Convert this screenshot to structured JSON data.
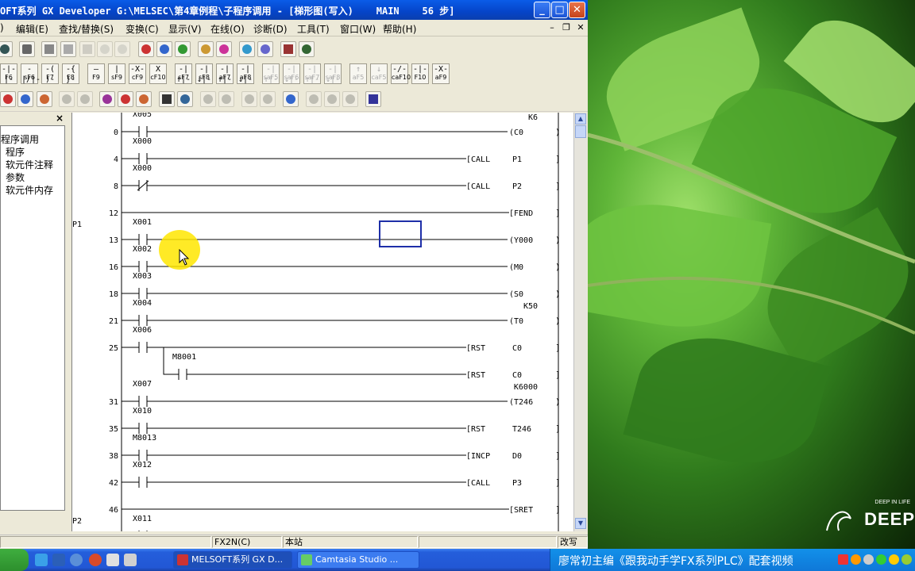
{
  "window": {
    "title": "OFT系列 GX Developer G:\\MELSEC\\第4章例程\\子程序调用 - [梯形图(写入)    MAIN    56 步]"
  },
  "menu": [
    "编辑(E)",
    "查找/替换(S)",
    "变换(C)",
    "显示(V)",
    "在线(O)",
    "诊断(D)",
    "工具(T)",
    "窗口(W)",
    "帮助(H)"
  ],
  "fkeys": [
    {
      "sym": "-|-|-",
      "label": "F6",
      "enabled": true
    },
    {
      "sym": "-|/|-",
      "label": "sF6",
      "enabled": true
    },
    {
      "sym": "-( )-",
      "label": "F7",
      "enabled": true
    },
    {
      "sym": "-{ }-",
      "label": "F8",
      "enabled": true
    },
    {
      "sym": "—",
      "label": "F9",
      "enabled": true
    },
    {
      "sym": "|",
      "label": "sF9",
      "enabled": true
    },
    {
      "sym": "-X-",
      "label": "cF9",
      "enabled": true
    },
    {
      "sym": "X",
      "label": "cF10",
      "enabled": true
    },
    {
      "sym": "-|↑|-",
      "label": "sF7",
      "enabled": true
    },
    {
      "sym": "-|↓|-",
      "label": "sF8",
      "enabled": true
    },
    {
      "sym": "-|↑|-",
      "label": "aF7",
      "enabled": true
    },
    {
      "sym": "-|↓|-",
      "label": "aF8",
      "enabled": true
    },
    {
      "sym": "-|↑|-",
      "label": "saF5",
      "enabled": false
    },
    {
      "sym": "-|↓|-",
      "label": "saF6",
      "enabled": false
    },
    {
      "sym": "-|↑|-",
      "label": "saF7",
      "enabled": false
    },
    {
      "sym": "-|↓|-",
      "label": "saF8",
      "enabled": false
    },
    {
      "sym": "↑",
      "label": "aF5",
      "enabled": false
    },
    {
      "sym": "↓",
      "label": "caF5",
      "enabled": false
    },
    {
      "sym": "-/-",
      "label": "caF10",
      "enabled": true
    },
    {
      "sym": "-|-",
      "label": "F10",
      "enabled": true
    },
    {
      "sym": "-X-",
      "label": "aF9",
      "enabled": true
    }
  ],
  "tree": {
    "items": [
      "程序调用",
      "程序",
      "软元件注释",
      "参数",
      "软元件内存"
    ],
    "close": "×"
  },
  "ladder": {
    "rungs": [
      {
        "step": "0",
        "contacts": [
          {
            "dev": "X005",
            "type": "no"
          }
        ],
        "coil": "(C0",
        "coil_type": "out",
        "k": "K6"
      },
      {
        "step": "4",
        "contacts": [
          {
            "dev": "X000",
            "type": "no"
          }
        ],
        "coil": "[CALL",
        "arg": "P1",
        "coil_type": "inst"
      },
      {
        "step": "8",
        "contacts": [
          {
            "dev": "X000",
            "type": "nc"
          }
        ],
        "coil": "[CALL",
        "arg": "P2",
        "coil_type": "inst"
      },
      {
        "step": "12",
        "contacts": [],
        "coil": "[FEND",
        "coil_type": "inst"
      },
      {
        "step": "13",
        "pointer": "P1",
        "contacts": [
          {
            "dev": "X001",
            "type": "no"
          }
        ],
        "coil": "(Y000",
        "coil_type": "out"
      },
      {
        "step": "16",
        "contacts": [
          {
            "dev": "X002",
            "type": "no"
          }
        ],
        "coil": "(M0",
        "coil_type": "out"
      },
      {
        "step": "18",
        "contacts": [
          {
            "dev": "X003",
            "type": "no"
          }
        ],
        "coil": "(S0",
        "coil_type": "out"
      },
      {
        "step": "21",
        "contacts": [
          {
            "dev": "X004",
            "type": "no"
          }
        ],
        "coil": "(T0",
        "coil_type": "out",
        "k": "K50"
      },
      {
        "step": "25",
        "contacts": [
          {
            "dev": "X006",
            "type": "no"
          }
        ],
        "coil": "[RST",
        "arg": "C0",
        "coil_type": "inst"
      },
      {
        "step": "",
        "branch": true,
        "contacts": [
          {
            "dev": "M8001",
            "type": "no"
          }
        ],
        "coil": "[RST",
        "arg": "C0",
        "coil_type": "inst"
      },
      {
        "step": "31",
        "contacts": [
          {
            "dev": "X007",
            "type": "no"
          }
        ],
        "coil": "(T246",
        "coil_type": "out",
        "k": "K6000"
      },
      {
        "step": "35",
        "contacts": [
          {
            "dev": "X010",
            "type": "no"
          }
        ],
        "coil": "[RST",
        "arg": "T246",
        "coil_type": "inst"
      },
      {
        "step": "38",
        "contacts": [
          {
            "dev": "M8013",
            "type": "no"
          }
        ],
        "coil": "[INCP",
        "arg": "D0",
        "coil_type": "inst"
      },
      {
        "step": "42",
        "contacts": [
          {
            "dev": "X012",
            "type": "no"
          }
        ],
        "coil": "[CALL",
        "arg": "P3",
        "coil_type": "inst"
      },
      {
        "step": "46",
        "contacts": [],
        "coil": "[SRET",
        "coil_type": "inst"
      },
      {
        "step": "",
        "pointer": "P2",
        "contacts": [
          {
            "dev": "X011",
            "type": "no"
          }
        ],
        "coil": "",
        "coil_type": "none"
      }
    ]
  },
  "status": {
    "plc": "FX2N(C)",
    "station": "本站",
    "mode": "改写"
  },
  "taskbar": {
    "tasks": [
      "MELSOFT系列 GX D...",
      "Camtasia Studio ..."
    ],
    "caption": "廖常初主编《跟我动手学FX系列PLC》配套视频"
  },
  "desktop": {
    "logo_small": "DEEP IN LIFE",
    "logo_big": "DEEP"
  },
  "colors": {
    "title_blue": "#0a5ce8",
    "taskbar_blue": "#245edb",
    "selection_box": "#1e2fa8",
    "cursor_highlight": "#ffe600"
  }
}
